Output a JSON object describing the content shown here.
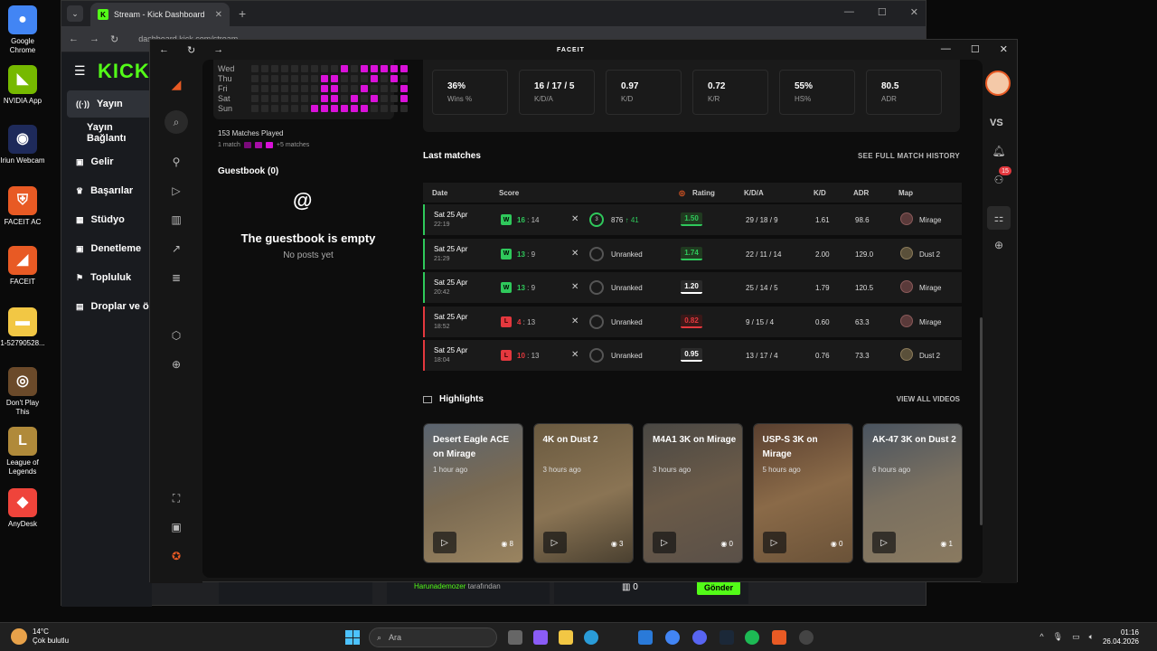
{
  "desktop_icons": [
    {
      "label": "Google Chrome",
      "color": "#4285f4",
      "glyph": "●"
    },
    {
      "label": "NVIDIA App",
      "color": "#76b900",
      "glyph": "◣"
    },
    {
      "label": "Iriun Webcam",
      "color": "#1e2a5a",
      "glyph": "◉"
    },
    {
      "label": "FACEIT AC",
      "color": "#e85a24",
      "glyph": "⛨"
    },
    {
      "label": "FACEIT",
      "color": "#e85a24",
      "glyph": "◢"
    },
    {
      "label": "1-52790528...",
      "color": "#f2c744",
      "glyph": "▬"
    },
    {
      "label": "Don't Play This",
      "color": "#6b4a2a",
      "glyph": "◎"
    },
    {
      "label": "League of Legends",
      "color": "#b08a3a",
      "glyph": "L"
    },
    {
      "label": "AnyDesk",
      "color": "#ef443b",
      "glyph": "◆"
    }
  ],
  "chrome": {
    "tab_title": "Stream - Kick Dashboard",
    "url": "dashboard.kick.com/stream"
  },
  "kick": {
    "logo": "KICK",
    "nav": [
      "Yayın",
      "Yayın Bağlantı",
      "Gelir",
      "Başarılar",
      "Stüdyo",
      "Denetleme",
      "Topluluk",
      "Droplar ve ö"
    ],
    "chat_user": "Harunademozer",
    "chat_suffix": "tarafından",
    "counter": "0",
    "send_label": "Gönder"
  },
  "faceit": {
    "title": "FACEIT",
    "heatmap_days": [
      "Wed",
      "Thu",
      "Fri",
      "Sat",
      "Sun"
    ],
    "matches_played": "153 Matches Played",
    "legend_low": "1 match",
    "legend_high": "+5 matches",
    "guestbook_title": "Guestbook (0)",
    "guestbook_empty": "The guestbook is empty",
    "guestbook_none": "No posts yet",
    "stats": [
      {
        "value": "36%",
        "label": "Wins %"
      },
      {
        "value": "16 / 17 / 5",
        "label": "K/D/A"
      },
      {
        "value": "0.97",
        "label": "K/D"
      },
      {
        "value": "0.72",
        "label": "K/R"
      },
      {
        "value": "55%",
        "label": "HS%"
      },
      {
        "value": "80.5",
        "label": "ADR"
      }
    ],
    "last_matches_title": "Last matches",
    "see_full": "SEE FULL MATCH HISTORY",
    "table_headers": {
      "date": "Date",
      "score": "Score",
      "rating": "Rating",
      "kda": "K/D/A",
      "kd": "K/D",
      "adr": "ADR",
      "map": "Map"
    },
    "matches": [
      {
        "date": "Sat 25 Apr",
        "time": "22:19",
        "result": "W",
        "score_won": "16",
        "score_other": "14",
        "elo": "876",
        "elo_change": "↑ 41",
        "level": "3",
        "rating": "1.50",
        "kda": "29 / 18 / 9",
        "kd": "1.61",
        "adr": "98.6",
        "map": "Mirage",
        "win": true
      },
      {
        "date": "Sat 25 Apr",
        "time": "21:29",
        "result": "W",
        "score_won": "13",
        "score_other": "9",
        "elo": "Unranked",
        "elo_change": "",
        "level": "",
        "rating": "1.74",
        "kda": "22 / 11 / 14",
        "kd": "2.00",
        "adr": "129.0",
        "map": "Dust 2",
        "win": true
      },
      {
        "date": "Sat 25 Apr",
        "time": "20:42",
        "result": "W",
        "score_won": "13",
        "score_other": "9",
        "elo": "Unranked",
        "elo_change": "",
        "level": "",
        "rating": "1.20",
        "kda": "25 / 14 / 5",
        "kd": "1.79",
        "adr": "120.5",
        "map": "Mirage",
        "win": true
      },
      {
        "date": "Sat 25 Apr",
        "time": "18:52",
        "result": "L",
        "score_won": "4",
        "score_other": "13",
        "elo": "Unranked",
        "elo_change": "",
        "level": "",
        "rating": "0.82",
        "kda": "9 / 15 / 4",
        "kd": "0.60",
        "adr": "63.3",
        "map": "Mirage",
        "win": false
      },
      {
        "date": "Sat 25 Apr",
        "time": "18:04",
        "result": "L",
        "score_won": "10",
        "score_other": "13",
        "elo": "Unranked",
        "elo_change": "",
        "level": "",
        "rating": "0.95",
        "kda": "13 / 17 / 4",
        "kd": "0.76",
        "adr": "73.3",
        "map": "Dust 2",
        "win": false
      }
    ],
    "highlights_title": "Highlights",
    "view_all": "VIEW ALL VIDEOS",
    "highlights": [
      {
        "title": "Desert Eagle ACE on Mirage",
        "age": "1 hour ago",
        "views": "8"
      },
      {
        "title": "4K on Dust 2",
        "age": "3 hours ago",
        "views": "3"
      },
      {
        "title": "M4A1 3K on Mirage",
        "age": "3 hours ago",
        "views": "0"
      },
      {
        "title": "USP-S 3K on Mirage",
        "age": "5 hours ago",
        "views": "0"
      },
      {
        "title": "AK-47 3K on Dust 2",
        "age": "6 hours ago",
        "views": "1"
      }
    ],
    "right_vs": "VS",
    "friends_badge": "15"
  },
  "taskbar": {
    "temp": "14°C",
    "weather": "Çok bulutlu",
    "search": "Ara",
    "time": "01:16",
    "date": "26.04.2026"
  }
}
